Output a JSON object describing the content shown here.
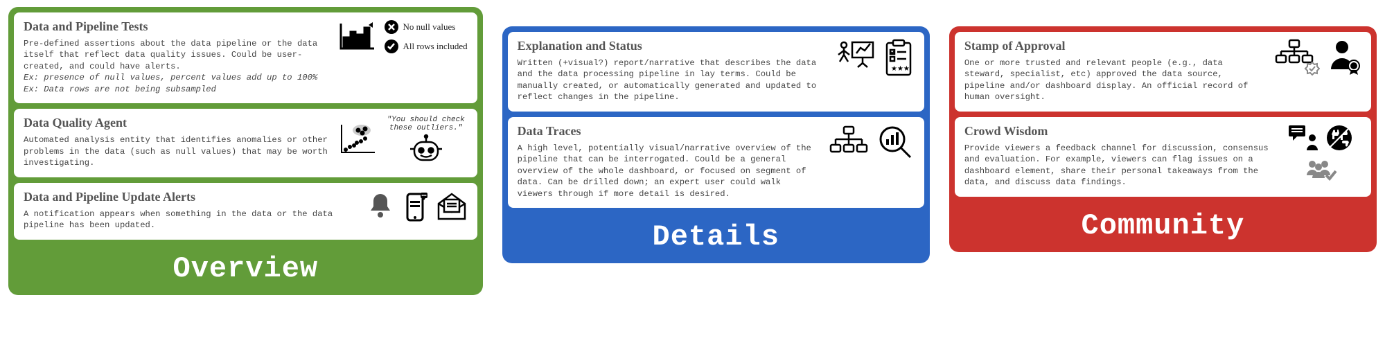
{
  "panels": {
    "overview": {
      "title": "Overview",
      "cards": [
        {
          "title": "Data and Pipeline Tests",
          "desc": "Pre-defined assertions about the data pipeline or the data itself that reflect data quality issues.\nCould be user-created, and could have alerts.",
          "ex1": "Ex: presence of null values, percent values add up to 100%",
          "ex2": "Ex: Data rows are not being subsampled",
          "badge1": "No null values",
          "badge2": "All rows included"
        },
        {
          "title": "Data Quality Agent",
          "desc": "Automated analysis entity that identifies anomalies or other problems in the data (such as null values) that may be worth investigating.",
          "quote": "\"You should check these outliers.\""
        },
        {
          "title": "Data and Pipeline Update Alerts",
          "desc": "A notification appears when something in the data or the data pipeline has been updated."
        }
      ]
    },
    "details": {
      "title": "Details",
      "cards": [
        {
          "title": "Explanation and Status",
          "desc": "Written (+visual?) report/narrative that describes the data and the data processing pipeline in lay terms. Could be manually created, or automatically generated and updated to reflect changes in the pipeline."
        },
        {
          "title": "Data Traces",
          "desc": "A high level, potentially visual/narrative overview of the pipeline that can be interrogated. Could be a general overview of the whole dashboard, or focused on segment of data. Can be drilled down; an expert user could walk viewers through if more detail is desired."
        }
      ]
    },
    "community": {
      "title": "Community",
      "cards": [
        {
          "title": "Stamp of Approval",
          "desc": "One or more trusted and relevant people (e.g., data steward, specialist, etc) approved the data source, pipeline and/or dashboard display. An official record of human oversight."
        },
        {
          "title": "Crowd Wisdom",
          "desc": "Provide viewers a feedback channel for discussion, consensus and evaluation. For example, viewers can flag issues on a dashboard element, share their personal takeaways from the data, and discuss data findings."
        }
      ]
    }
  }
}
